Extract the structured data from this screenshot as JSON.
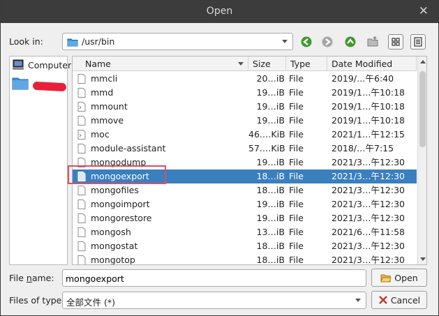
{
  "window": {
    "title": "Open"
  },
  "lookin": {
    "label": "Look in:",
    "path": "/usr/bin"
  },
  "toolbar": {
    "back_icon": "back-arrow-icon",
    "forward_icon": "forward-arrow-icon",
    "up_icon": "up-arrow-icon",
    "new_folder_icon": "new-folder-icon",
    "list_view_icon": "list-view-icon",
    "detail_view_icon": "detail-view-icon"
  },
  "sidebar": {
    "items": [
      {
        "label": "Computer",
        "icon": "computer-icon"
      },
      {
        "label": "",
        "icon": "folder-icon"
      }
    ]
  },
  "filelist": {
    "columns": [
      "Name",
      "Size",
      "Type",
      "Date Modified"
    ],
    "rows": [
      {
        "name": "mmcli",
        "size": "20…iB",
        "type": "File",
        "date": "2019/…午6:40",
        "icon": "file-icon"
      },
      {
        "name": "mmd",
        "size": "19…iB",
        "type": "File",
        "date": "2019/1…午10:18",
        "icon": "file-icon"
      },
      {
        "name": "mmount",
        "size": "19…iB",
        "type": "File",
        "date": "2019/1…午10:18",
        "icon": "script-file-icon"
      },
      {
        "name": "mmove",
        "size": "19…iB",
        "type": "File",
        "date": "2019/1…午10:18",
        "icon": "file-icon"
      },
      {
        "name": "moc",
        "size": "46.…KiB",
        "type": "File",
        "date": "2021/1…午12:15",
        "icon": "script-file-icon"
      },
      {
        "name": "module-assistant",
        "size": "57.…KiB",
        "type": "File",
        "date": "2018/…午7:15",
        "icon": "file-icon"
      },
      {
        "name": "mongodump",
        "size": "19…iB",
        "type": "File",
        "date": "2021/3…午12:30",
        "icon": "file-icon"
      },
      {
        "name": "mongoexport",
        "size": "18…iB",
        "type": "File",
        "date": "2021/3…午12:30",
        "icon": "file-icon",
        "selected": true
      },
      {
        "name": "mongofiles",
        "size": "18…iB",
        "type": "File",
        "date": "2021/3…午12:30",
        "icon": "file-icon"
      },
      {
        "name": "mongoimport",
        "size": "19…iB",
        "type": "File",
        "date": "2021/3…午12:30",
        "icon": "file-icon"
      },
      {
        "name": "mongorestore",
        "size": "19…iB",
        "type": "File",
        "date": "2021/3…午12:30",
        "icon": "file-icon"
      },
      {
        "name": "mongosh",
        "size": "13…iB",
        "type": "File",
        "date": "2021/6…午11:58",
        "icon": "file-icon"
      },
      {
        "name": "mongostat",
        "size": "18…iB",
        "type": "File",
        "date": "2021/3…午12:30",
        "icon": "file-icon"
      },
      {
        "name": "mongotop",
        "size": "18…iB",
        "type": "File",
        "date": "2021/3…午12:30",
        "icon": "file-icon"
      }
    ]
  },
  "form": {
    "filename_label_prefix": "File ",
    "filename_label_underlined": "n",
    "filename_label_suffix": "ame:",
    "filename_value": "mongoexport",
    "filetype_label": "Files of type:",
    "filetype_value": "全部文件 (*)"
  },
  "buttons": {
    "open": "Open",
    "cancel": "Cancel"
  },
  "colors": {
    "selection": "#3a7fbe",
    "highlight_outline": "#e24a6a",
    "nav_green": "#3f9a2e"
  }
}
